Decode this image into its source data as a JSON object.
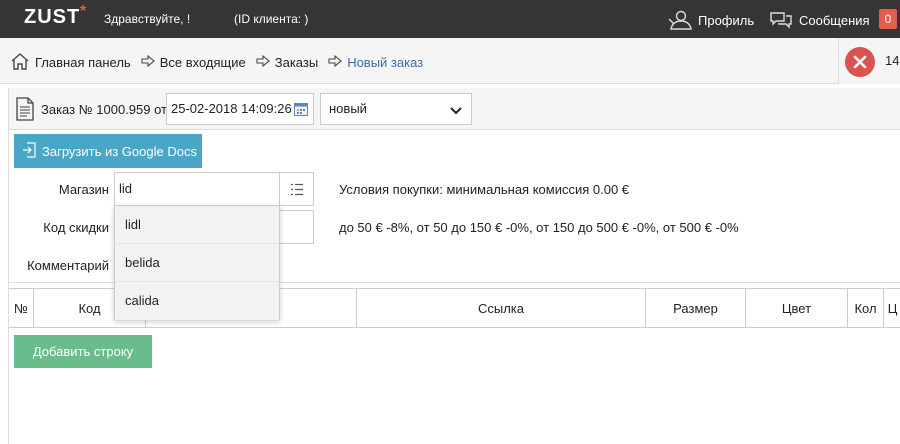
{
  "topbar": {
    "logo": "ZUST",
    "logo_star": "*",
    "greeting": "Здравствуйте,       !",
    "client_id": "(ID клиента:  )",
    "profile_label": "Профиль",
    "messages_label": "Сообщения",
    "messages_count": "0"
  },
  "breadcrumbs": {
    "home": "Главная панель",
    "inbox": "Все входящие",
    "orders": "Заказы",
    "new_order": "Новый заказ",
    "counter": "14"
  },
  "order": {
    "label": "Заказ № 1000.959 от",
    "date": "25-02-2018 14:09:26",
    "status": "новый"
  },
  "form": {
    "gdocs_button": "Загрузить из Google Docs",
    "shop_label": "Магазин",
    "shop_value": "lid",
    "discount_label": "Код скидки",
    "comment_label": "Комментарий",
    "purchase_conditions": "Условия покупки: минимальная комиссия 0.00 €",
    "discount_tiers": "до 50 € -8%, от 50 до 150 € -0%, от 150 до 500 € -0%, от 500 € -0%"
  },
  "dropdown": {
    "options": [
      "lidl",
      "belida",
      "calida"
    ]
  },
  "table": {
    "headers": [
      "№",
      "Код",
      "",
      "Ссылка",
      "Размер",
      "Цвет",
      "Кол",
      "Ц"
    ]
  },
  "add_row_button": "Добавить строку",
  "colors": {
    "topbar": "#353535",
    "accent_red": "#e65c4f",
    "gdocs_blue": "#4aa6c7",
    "add_green": "#6abc8d",
    "link_blue": "#3b6fa6"
  }
}
